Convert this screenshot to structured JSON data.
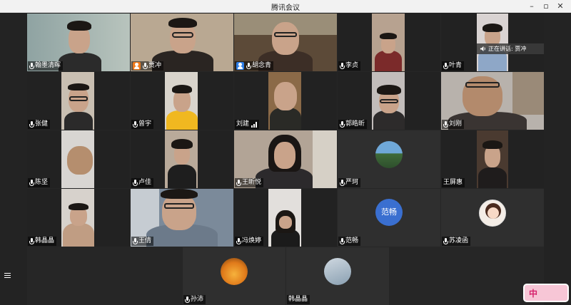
{
  "window": {
    "title": "腾讯会议"
  },
  "speaking": {
    "label": "正在讲话: 贾冲"
  },
  "participants": [
    "翰墨清晖",
    "贾冲",
    "胡念青",
    "李贞",
    "叶青",
    "张健",
    "曾宇",
    "刘建",
    "郭皓昕",
    "刘刚",
    "陈坚",
    "卢佳",
    "王昕悦",
    "严珂",
    "王屏惠",
    "韩晶晶",
    "王倩",
    "冯焕婷",
    "范畅",
    "苏凌函",
    "孙沛",
    "韩晶晶"
  ],
  "avatar_text": {
    "fanchang": "范畅"
  },
  "logo": {
    "text": "中"
  },
  "colors": {
    "accent_blue": "#2e7fe8",
    "host_orange": "#f07a1c",
    "avatar_blue": "#3a6fd0"
  }
}
